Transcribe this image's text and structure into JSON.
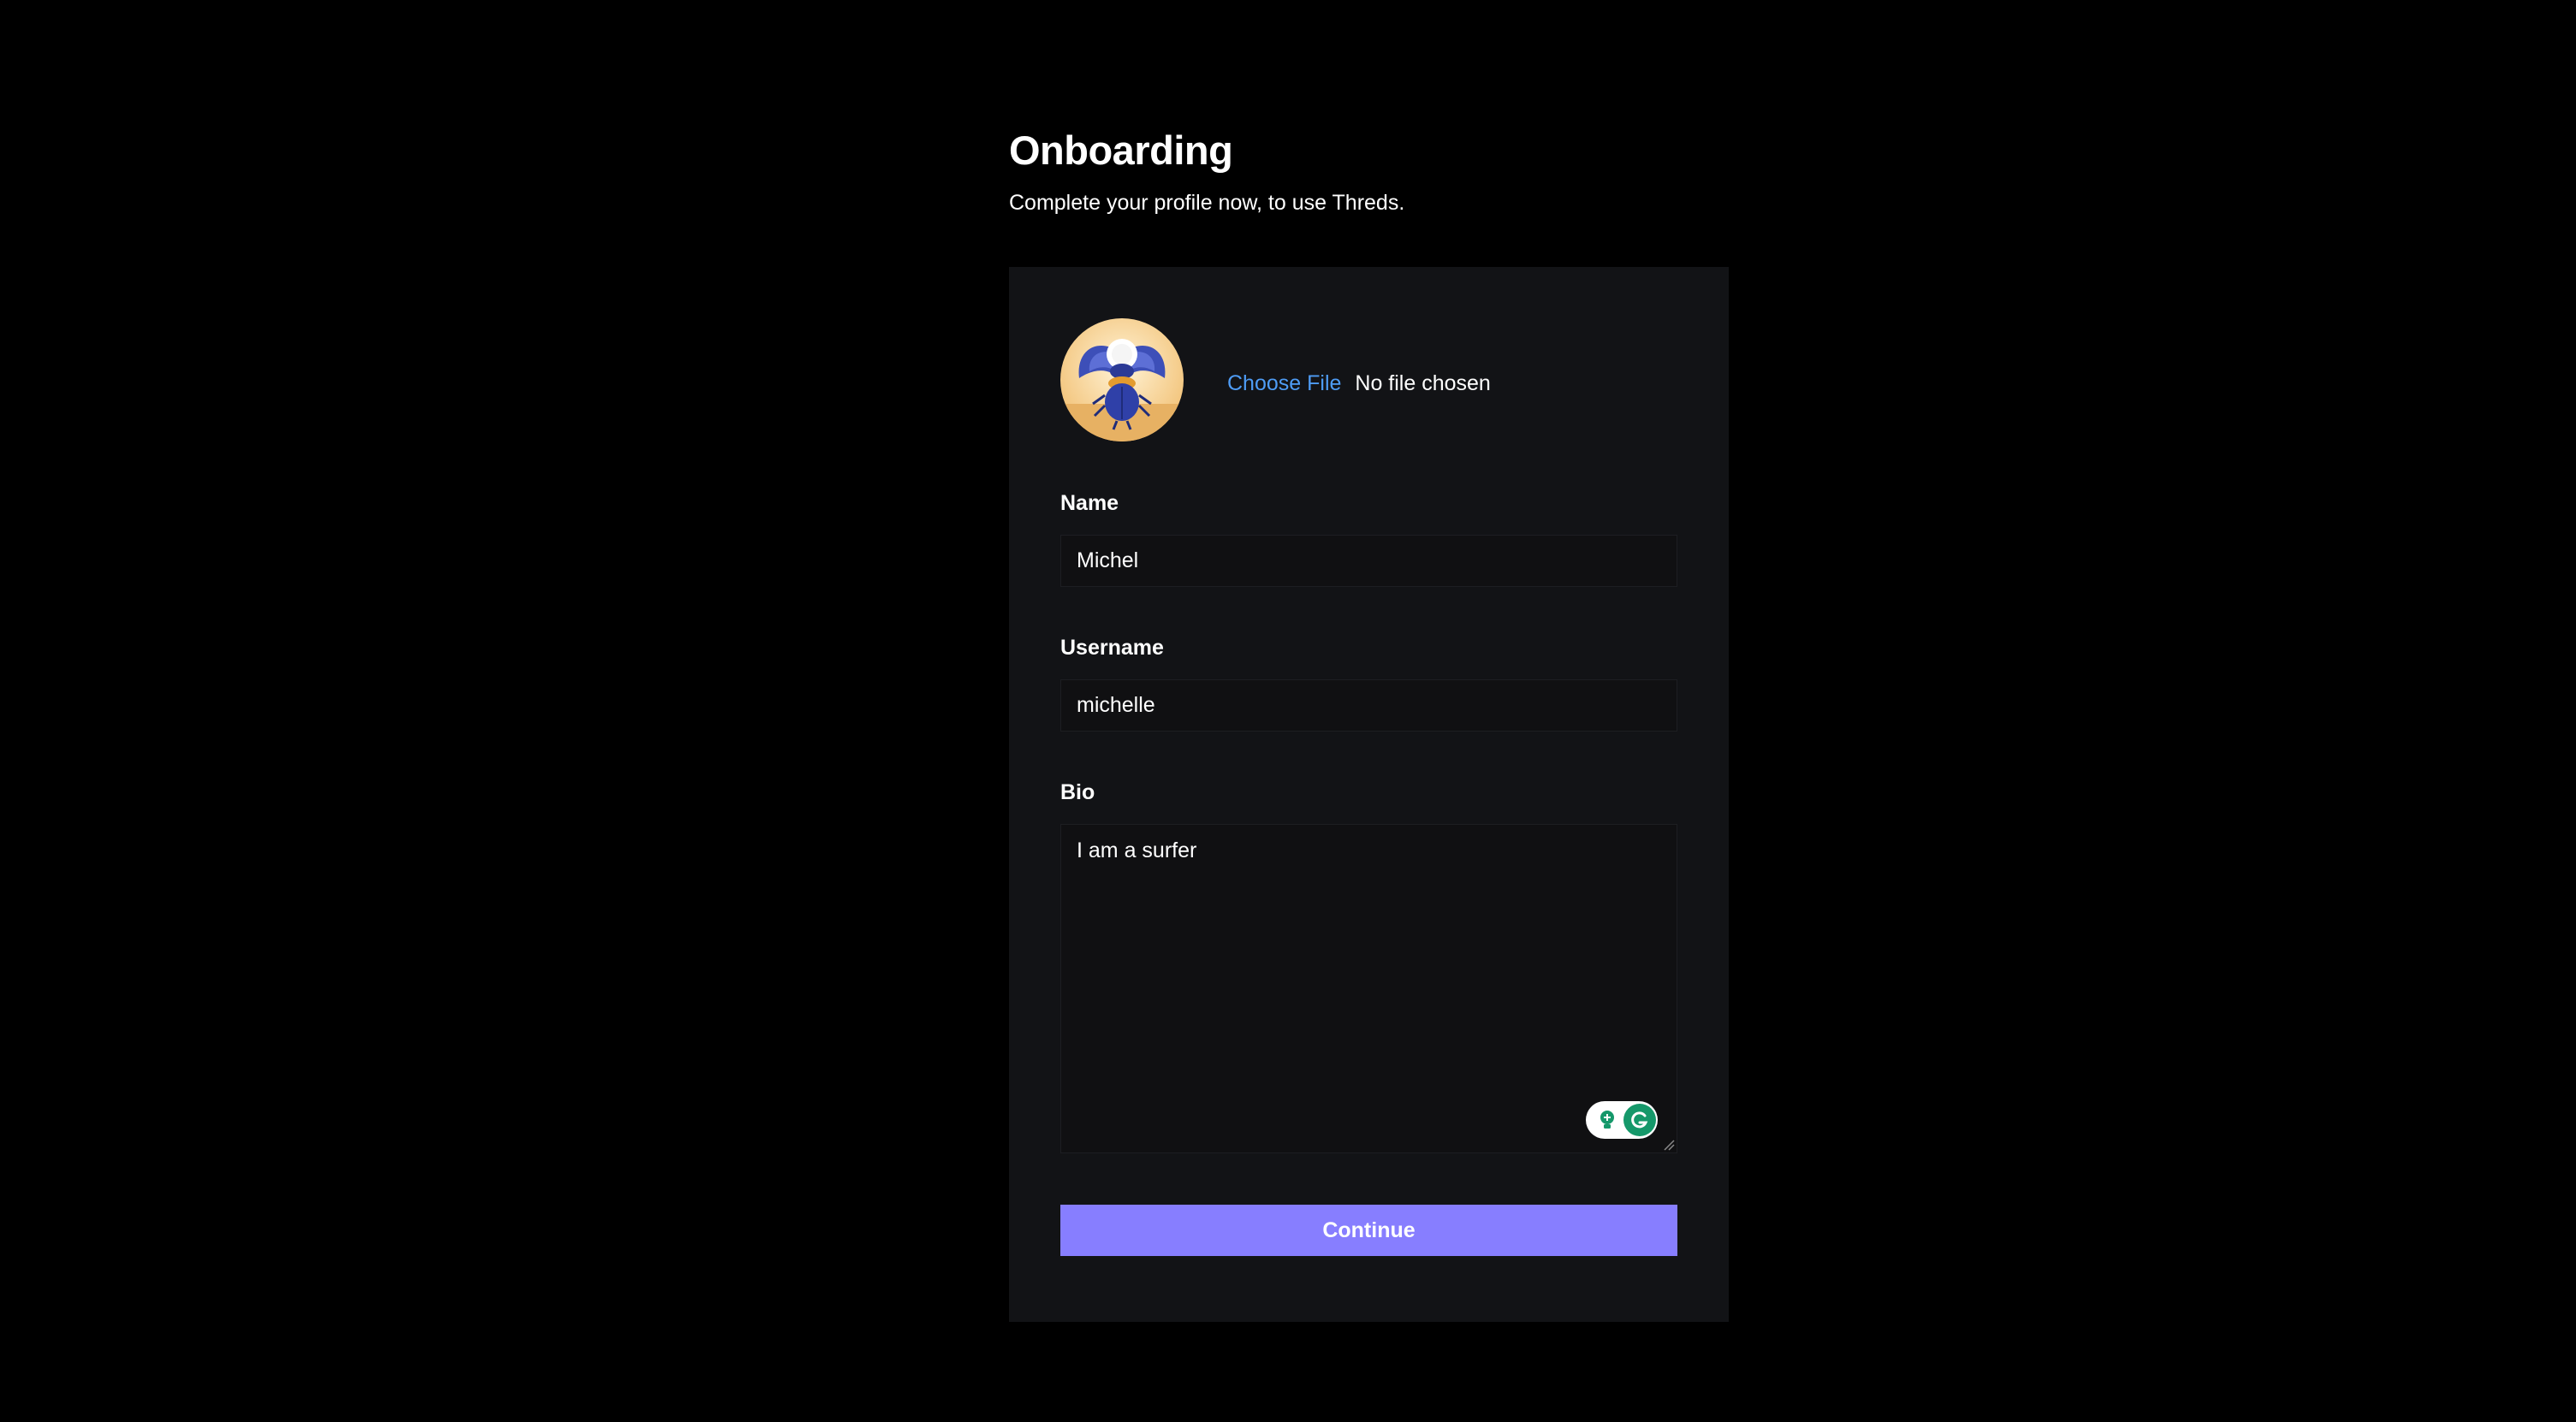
{
  "header": {
    "title": "Onboarding",
    "subtitle": "Complete your profile now, to use Threds."
  },
  "profile_form": {
    "avatar_icon": "scarab-beetle-avatar",
    "file_input": {
      "button_label": "Choose File",
      "status_text": "No file chosen"
    },
    "name": {
      "label": "Name",
      "value": "Michel"
    },
    "username": {
      "label": "Username",
      "value": "michelle"
    },
    "bio": {
      "label": "Bio",
      "value": "I am a surfer"
    },
    "submit_label": "Continue"
  },
  "extension": {
    "icon": "grammarly-icon"
  },
  "colors": {
    "background": "#000000",
    "card": "#121316",
    "input_bg": "#101012",
    "accent": "#877eff",
    "link": "#4e9cf5"
  }
}
